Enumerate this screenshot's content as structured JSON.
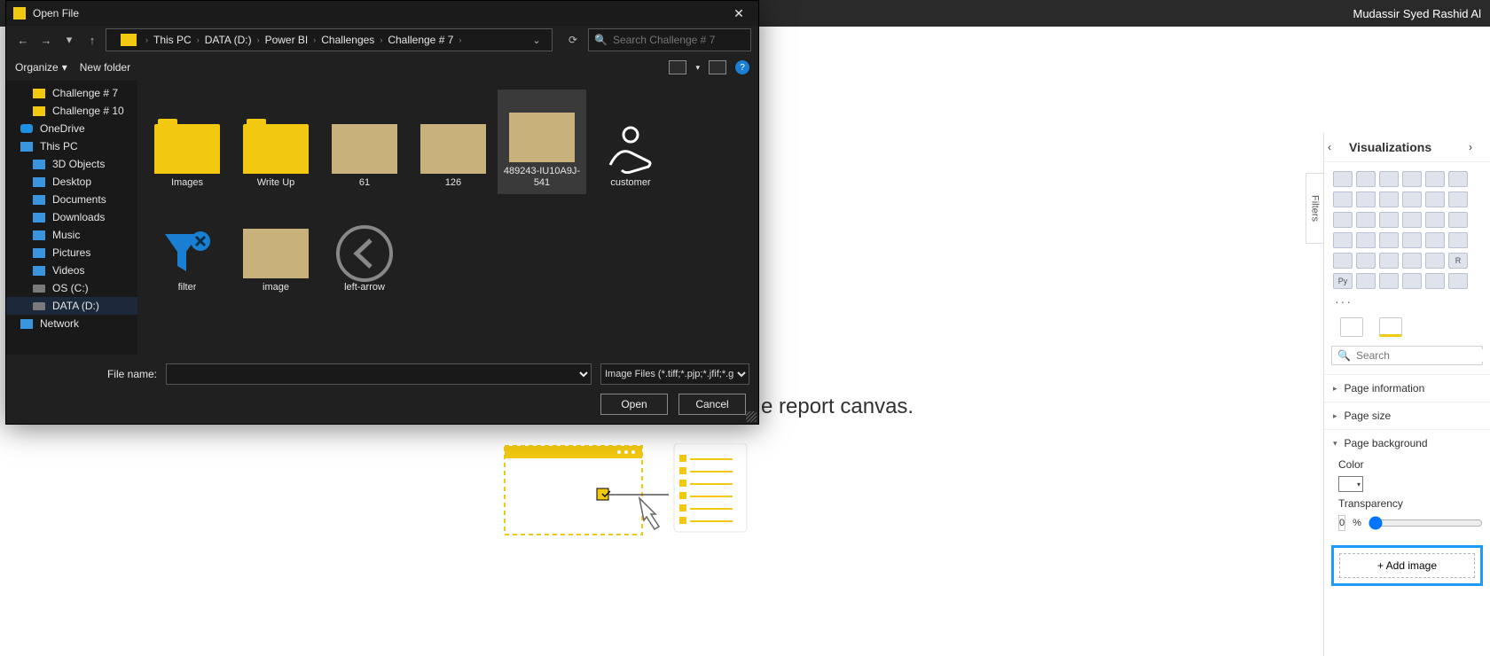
{
  "app": {
    "user": "Mudassir Syed Rashid Al"
  },
  "canvas": {
    "hint": "e report canvas."
  },
  "filters": {
    "label": "Filters"
  },
  "viz": {
    "title": "Visualizations",
    "more": "···",
    "search_placeholder": "Search",
    "sections": {
      "page_info": "Page information",
      "page_size": "Page size",
      "page_bg": "Page background"
    },
    "bg": {
      "color_label": "Color",
      "transparency_label": "Transparency",
      "transparency_value": "0",
      "transparency_unit": "%",
      "add_image": "+ Add image"
    },
    "r_cell": "R",
    "py_cell": "Py"
  },
  "dialog": {
    "title": "Open File",
    "breadcrumb": [
      "This PC",
      "DATA (D:)",
      "Power BI",
      "Challenges",
      "Challenge # 7"
    ],
    "search_placeholder": "Search Challenge # 7",
    "organize": "Organize",
    "new_folder": "New folder",
    "tree": [
      {
        "label": "Challenge # 7",
        "icon": "folder",
        "level": 2
      },
      {
        "label": "Challenge # 10",
        "icon": "folder",
        "level": 2
      },
      {
        "label": "OneDrive",
        "icon": "onedrive",
        "level": 1
      },
      {
        "label": "This PC",
        "icon": "pc",
        "level": 1
      },
      {
        "label": "3D Objects",
        "icon": "pc",
        "level": 2
      },
      {
        "label": "Desktop",
        "icon": "pc",
        "level": 2
      },
      {
        "label": "Documents",
        "icon": "pc",
        "level": 2
      },
      {
        "label": "Downloads",
        "icon": "pc",
        "level": 2
      },
      {
        "label": "Music",
        "icon": "pc",
        "level": 2
      },
      {
        "label": "Pictures",
        "icon": "pc",
        "level": 2
      },
      {
        "label": "Videos",
        "icon": "pc",
        "level": 2
      },
      {
        "label": "OS (C:)",
        "icon": "drive",
        "level": 2
      },
      {
        "label": "DATA (D:)",
        "icon": "drive",
        "level": 2,
        "selected": true
      },
      {
        "label": "Network",
        "icon": "net",
        "level": 1
      }
    ],
    "files": [
      {
        "name": "Images",
        "type": "folder"
      },
      {
        "name": "Write Up",
        "type": "folder"
      },
      {
        "name": "61",
        "type": "image"
      },
      {
        "name": "126",
        "type": "image"
      },
      {
        "name": "489243-IU10A9J-541",
        "type": "image",
        "selected": true
      },
      {
        "name": "customer",
        "type": "icon"
      },
      {
        "name": "filter",
        "type": "icon"
      },
      {
        "name": "image",
        "type": "image"
      },
      {
        "name": "left-arrow",
        "type": "icon"
      }
    ],
    "file_name_label": "File name:",
    "filter_text": "Image Files (*.tiff;*.pjp;*.jfif;*.gi",
    "open": "Open",
    "cancel": "Cancel"
  }
}
